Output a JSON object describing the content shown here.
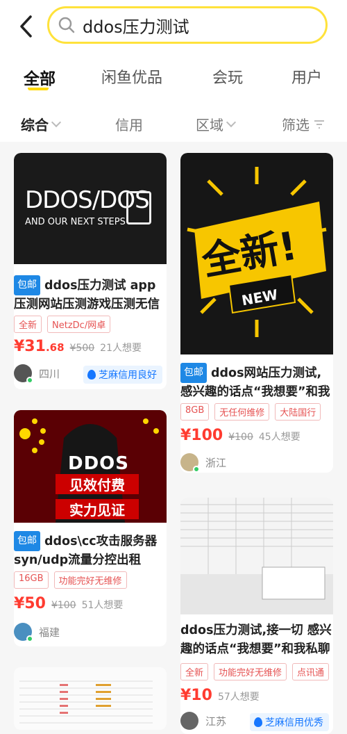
{
  "search": {
    "query": "ddos压力测试"
  },
  "tabs": [
    "全部",
    "闲鱼优品",
    "会玩",
    "用户"
  ],
  "filters": [
    "综合",
    "信用",
    "区域",
    "筛选"
  ],
  "cards": [
    {
      "image_text": [
        "DDOS/DOS",
        "AND OUR NEXT STEPS"
      ],
      "badge": "包邮",
      "title": "ddos压力测试 app压测网站压测游戏压测无信誉",
      "tags": [
        "全新",
        "NetzDc/网卓"
      ],
      "price_int": "¥31",
      "price_dec": ".68",
      "old_price": "¥500",
      "wants": "21人想要",
      "location": "四川",
      "credit": "芝麻信用良好"
    },
    {
      "image_text": [
        "全新!",
        "NEW"
      ],
      "badge": "包邮",
      "title": "ddos网站压力测试, 感兴趣的话点“我想要”和我",
      "tags": [
        "8GB",
        "无任何维修",
        "大陆国行"
      ],
      "price_int": "¥100",
      "old_price": "¥100",
      "wants": "45人想要",
      "location": "浙江"
    },
    {
      "image_text": [
        "DDOS",
        "见效付费",
        "实力见证"
      ],
      "badge": "包邮",
      "title": "ddos\\cc攻击服务器 syn/udp流量分控出租",
      "tags": [
        "16GB",
        "功能完好无维修"
      ],
      "price_int": "¥50",
      "old_price": "¥100",
      "wants": "51人想要",
      "location": "福建"
    },
    {
      "title": "ddos压力测试,接一切 感兴趣的话点“我想要”和我私聊",
      "tags": [
        "全新",
        "功能完好无维修",
        "点讯通"
      ],
      "price_int": "¥10",
      "wants": "57人想要",
      "location": "江苏",
      "credit": "芝麻信用优秀"
    }
  ],
  "colors": {
    "accent": "#ffe23b",
    "price": "#ff3b30",
    "badge": "#1e88e5",
    "credit": "#1677ff"
  }
}
